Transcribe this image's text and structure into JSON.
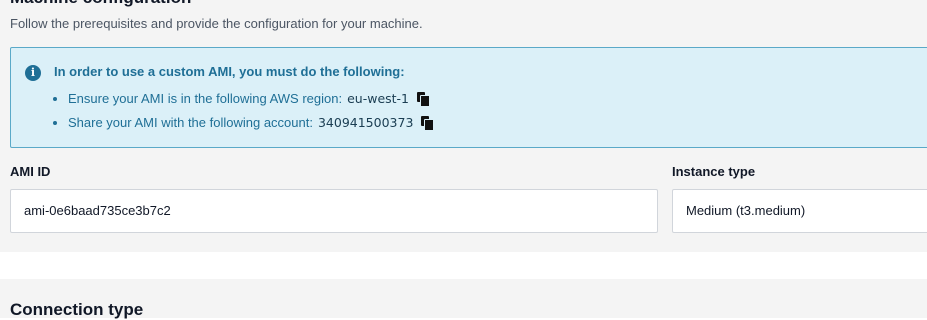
{
  "machine_config": {
    "title": "Machine configuration",
    "subtitle": "Follow the prerequisites and provide the configuration for your machine."
  },
  "info": {
    "icon": "info-icon",
    "heading": "In order to use a custom AMI, you must do the following:",
    "items": [
      {
        "text": "Ensure your AMI is in the following AWS region:",
        "value": "eu-west-1"
      },
      {
        "text": "Share your AMI with the following account:",
        "value": "340941500373"
      }
    ],
    "colors": {
      "background": "#dbf0f8",
      "border": "#5aa9c8",
      "text": "#1f6f96"
    }
  },
  "fields": {
    "ami_id": {
      "label": "AMI ID",
      "value": "ami-0e6baad735ce3b7c2"
    },
    "instance_type": {
      "label": "Instance type",
      "value": "Medium (t3.medium)"
    }
  },
  "connection": {
    "title": "Connection type"
  }
}
